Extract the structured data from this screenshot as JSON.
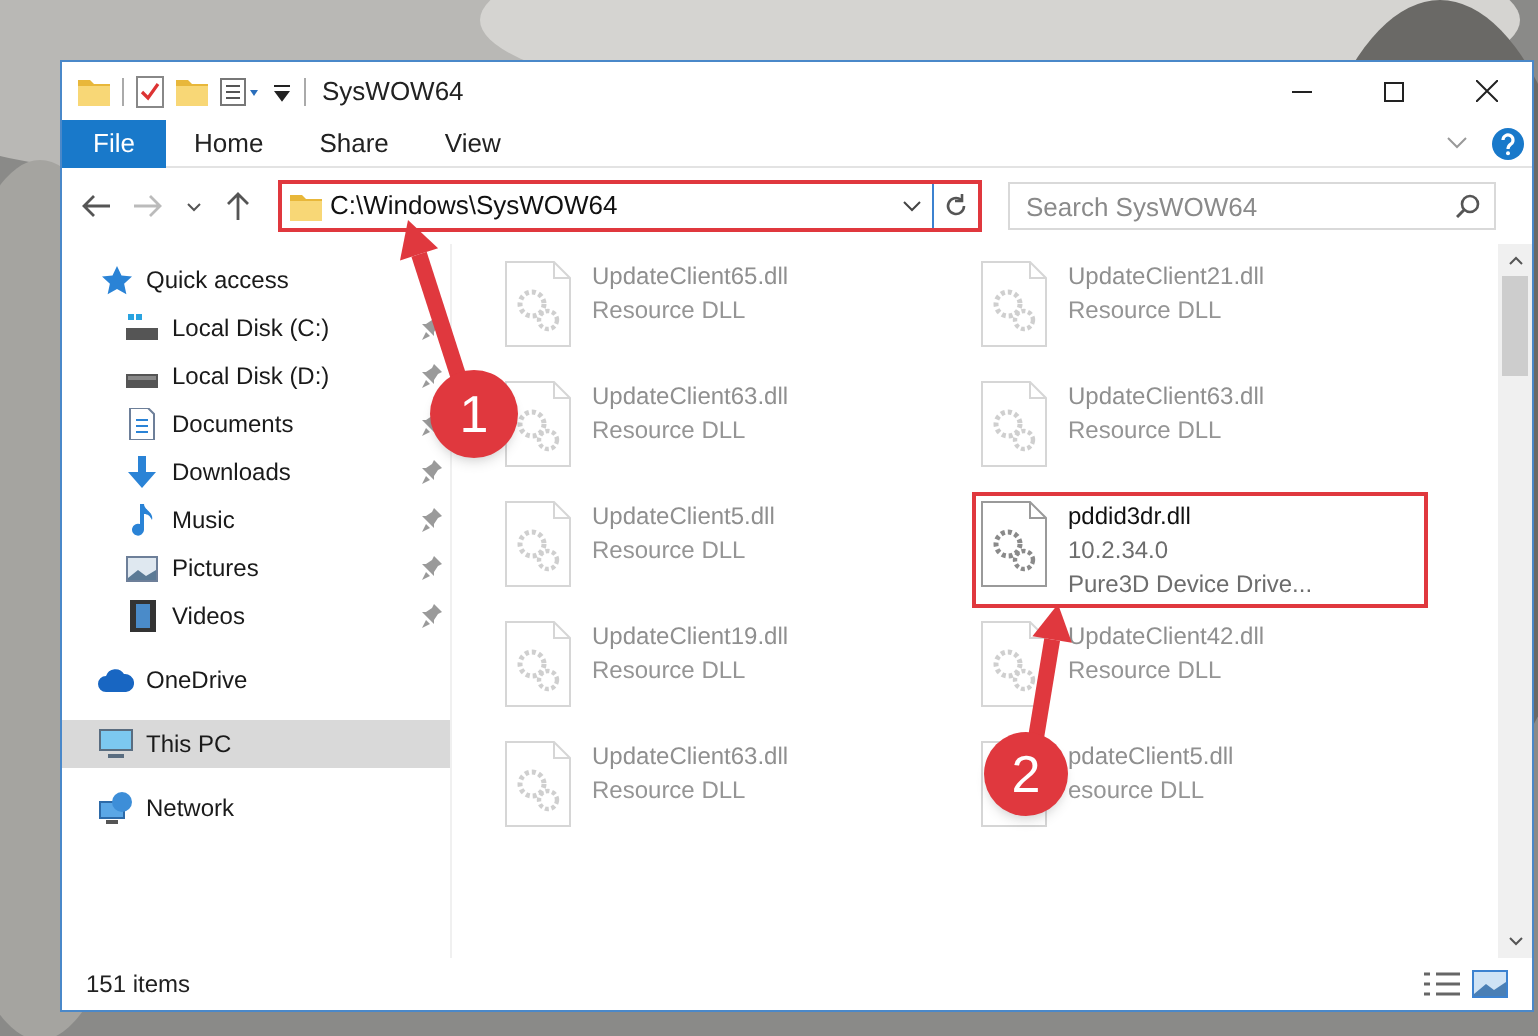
{
  "window": {
    "title": "SysWOW64"
  },
  "ribbon_tabs": [
    {
      "label": "File",
      "kind": "file"
    },
    {
      "label": "Home",
      "kind": "tab"
    },
    {
      "label": "Share",
      "kind": "tab"
    },
    {
      "label": "View",
      "kind": "tab"
    }
  ],
  "address": {
    "path": "C:\\Windows\\SysWOW64",
    "highlighted": true
  },
  "search": {
    "placeholder": "Search SysWOW64"
  },
  "sidebar": {
    "items": [
      {
        "label": "Quick access",
        "selected": false,
        "children": [
          {
            "label": "Local Disk (C:)",
            "pinned": true,
            "selected": false
          },
          {
            "label": "Local Disk (D:)",
            "pinned": true,
            "selected": false
          },
          {
            "label": "Documents",
            "pinned": true,
            "selected": false
          },
          {
            "label": "Downloads",
            "pinned": true,
            "selected": false
          },
          {
            "label": "Music",
            "pinned": true,
            "selected": false
          },
          {
            "label": "Pictures",
            "pinned": true,
            "selected": false
          },
          {
            "label": "Videos",
            "pinned": true,
            "selected": false
          }
        ]
      },
      {
        "label": "OneDrive",
        "selected": false
      },
      {
        "label": "This PC",
        "selected": true
      },
      {
        "label": "Network",
        "selected": false
      }
    ]
  },
  "files": [
    {
      "name": "UpdateClient65.dll",
      "lines": [
        "Resource DLL"
      ],
      "kind": "dimmed",
      "highlighted": false
    },
    {
      "name": "UpdateClient21.dll",
      "lines": [
        "Resource DLL"
      ],
      "kind": "dimmed",
      "highlighted": false
    },
    {
      "name": "UpdateClient63.dll",
      "lines": [
        "Resource DLL"
      ],
      "kind": "dimmed",
      "highlighted": false
    },
    {
      "name": "UpdateClient63.dll",
      "lines": [
        "Resource DLL"
      ],
      "kind": "dimmed",
      "highlighted": false
    },
    {
      "name": "UpdateClient5.dll",
      "lines": [
        "Resource DLL"
      ],
      "kind": "dimmed",
      "highlighted": false
    },
    {
      "name": "pddid3dr.dll",
      "lines": [
        "10.2.34.0",
        "Pure3D Device Drive..."
      ],
      "kind": "clear",
      "highlighted": true
    },
    {
      "name": "UpdateClient19.dll",
      "lines": [
        "Resource DLL"
      ],
      "kind": "dimmed",
      "highlighted": false
    },
    {
      "name": "UpdateClient42.dll",
      "lines": [
        "Resource DLL"
      ],
      "kind": "dimmed",
      "highlighted": false
    },
    {
      "name": "UpdateClient63.dll",
      "lines": [
        "Resource DLL"
      ],
      "kind": "dimmed",
      "highlighted": false
    },
    {
      "name": "pdateClient5.dll",
      "lines": [
        "esource DLL"
      ],
      "kind": "dimmed",
      "highlighted": false
    }
  ],
  "status_bar": {
    "count": "151 items"
  },
  "annotations": [
    {
      "label": "1"
    },
    {
      "label": "2"
    }
  ]
}
